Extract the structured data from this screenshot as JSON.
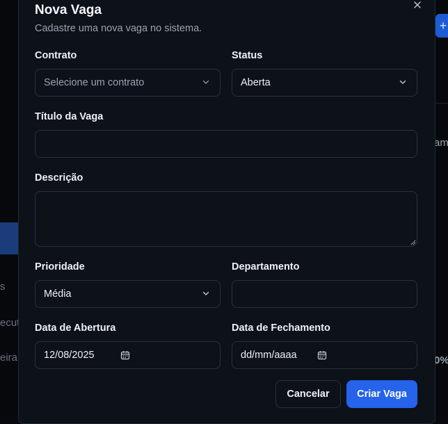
{
  "dialog": {
    "title": "Nova Vaga",
    "subtitle": "Cadastre uma nova vaga no sistema.",
    "close_icon": "close-icon"
  },
  "form": {
    "contrato": {
      "label": "Contrato",
      "placeholder": "Selecione um contrato"
    },
    "status": {
      "label": "Status",
      "value": "Aberta"
    },
    "titulo": {
      "label": "Título da Vaga",
      "value": ""
    },
    "descricao": {
      "label": "Descrição",
      "value": ""
    },
    "prioridade": {
      "label": "Prioridade",
      "value": "Média"
    },
    "departamento": {
      "label": "Departamento",
      "value": ""
    },
    "data_abertura": {
      "label": "Data de Abertura",
      "value": "12/08/2025"
    },
    "data_fechamento": {
      "label": "Data de Fechamento",
      "placeholder": "dd/mm/aaaa"
    }
  },
  "actions": {
    "cancel_label": "Cancelar",
    "submit_label": "Criar Vaga"
  },
  "background": {
    "fragments": [
      "am",
      "s",
      "ecut",
      "eira",
      "0%"
    ]
  },
  "colors": {
    "accent": "#2563eb",
    "panel": "#0d1118",
    "border": "#2a3140"
  }
}
